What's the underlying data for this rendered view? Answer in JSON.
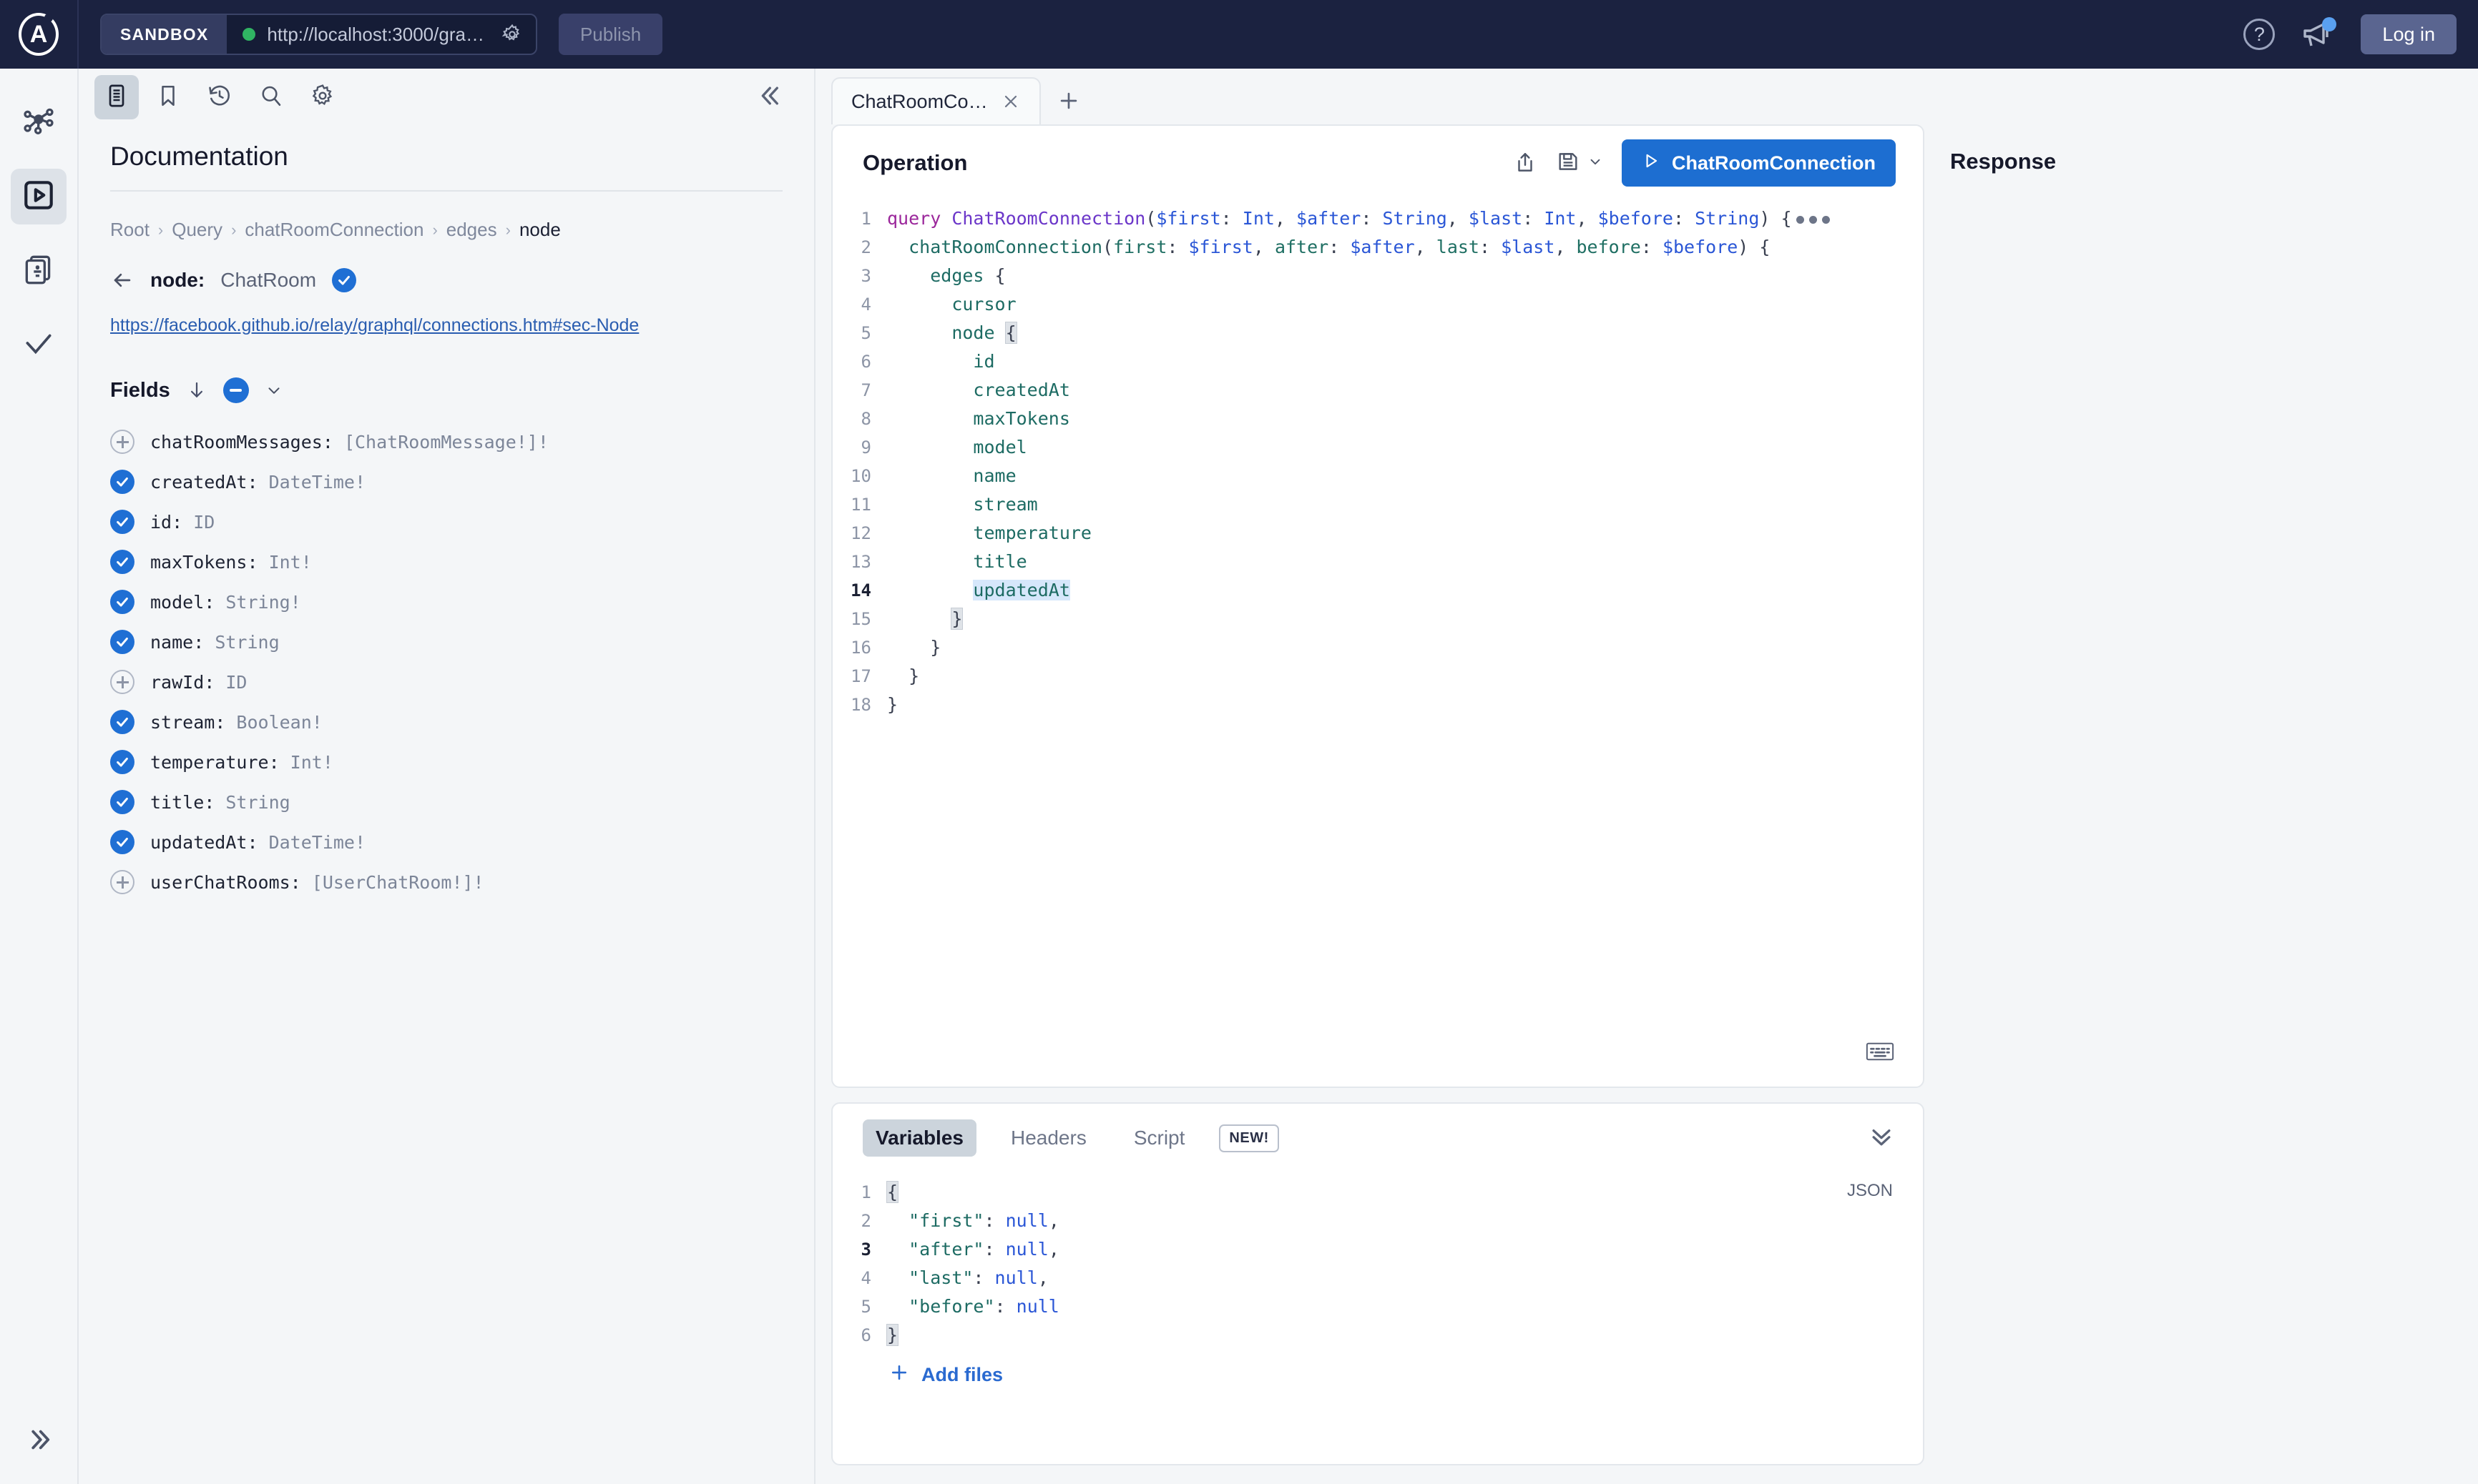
{
  "topbar": {
    "sandbox_label": "SANDBOX",
    "endpoint_url": "http://localhost:3000/gra…",
    "publish_label": "Publish",
    "login_label": "Log in",
    "status_color": "#30b463",
    "accent_color": "#1d6ed1"
  },
  "rail": {
    "items": [
      {
        "name": "graph-icon",
        "title": "Graph"
      },
      {
        "name": "explorer-icon",
        "title": "Explorer"
      },
      {
        "name": "checks-icon",
        "title": "Checks"
      },
      {
        "name": "check-icon",
        "title": "Verify"
      }
    ],
    "expand_label": "»"
  },
  "docs": {
    "tools": [
      "documentation-icon",
      "bookmark-icon",
      "history-icon",
      "search-icon",
      "settings-icon"
    ],
    "title": "Documentation",
    "breadcrumb": [
      "Root",
      "Query",
      "chatRoomConnection",
      "edges",
      "node"
    ],
    "node_name": "node:",
    "node_type": "ChatRoom",
    "doc_link": "https://facebook.github.io/relay/graphql/connections.htm#sec-Node",
    "fields_label": "Fields",
    "fields": [
      {
        "state": "plus",
        "name": "chatRoomMessages:",
        "type": "[ChatRoomMessage!]!"
      },
      {
        "state": "checked",
        "name": "createdAt:",
        "type": "DateTime!"
      },
      {
        "state": "checked",
        "name": "id:",
        "type": "ID"
      },
      {
        "state": "checked",
        "name": "maxTokens:",
        "type": "Int!"
      },
      {
        "state": "checked",
        "name": "model:",
        "type": "String!"
      },
      {
        "state": "checked",
        "name": "name:",
        "type": "String"
      },
      {
        "state": "plus",
        "name": "rawId:",
        "type": "ID"
      },
      {
        "state": "checked",
        "name": "stream:",
        "type": "Boolean!"
      },
      {
        "state": "checked",
        "name": "temperature:",
        "type": "Int!"
      },
      {
        "state": "checked",
        "name": "title:",
        "type": "String"
      },
      {
        "state": "checked",
        "name": "updatedAt:",
        "type": "DateTime!"
      },
      {
        "state": "plus",
        "name": "userChatRooms:",
        "type": "[UserChatRoom!]!"
      }
    ]
  },
  "tabs": {
    "items": [
      {
        "label": "ChatRoomCo…"
      }
    ],
    "add_label": "+"
  },
  "operation": {
    "title": "Operation",
    "run_label": "ChatRoomConnection",
    "current_line": 14,
    "code_lines": [
      {
        "n": 1,
        "raw": "query ChatRoomConnection($first: Int, $after: String, $last: Int, $before: String) {"
      },
      {
        "n": 2,
        "raw": "  chatRoomConnection(first: $first, after: $after, last: $last, before: $before) {"
      },
      {
        "n": 3,
        "raw": "    edges {"
      },
      {
        "n": 4,
        "raw": "      cursor"
      },
      {
        "n": 5,
        "raw": "      node {"
      },
      {
        "n": 6,
        "raw": "        id"
      },
      {
        "n": 7,
        "raw": "        createdAt"
      },
      {
        "n": 8,
        "raw": "        maxTokens"
      },
      {
        "n": 9,
        "raw": "        model"
      },
      {
        "n": 10,
        "raw": "        name"
      },
      {
        "n": 11,
        "raw": "        stream"
      },
      {
        "n": 12,
        "raw": "        temperature"
      },
      {
        "n": 13,
        "raw": "        title"
      },
      {
        "n": 14,
        "raw": "        updatedAt"
      },
      {
        "n": 15,
        "raw": "      }"
      },
      {
        "n": 16,
        "raw": "    }"
      },
      {
        "n": 17,
        "raw": "  }"
      },
      {
        "n": 18,
        "raw": "}"
      }
    ]
  },
  "variables": {
    "tabs": [
      {
        "label": "Variables",
        "active": true
      },
      {
        "label": "Headers",
        "active": false
      },
      {
        "label": "Script",
        "active": false
      }
    ],
    "new_badge": "NEW!",
    "format_label": "JSON",
    "current_line": 3,
    "json_lines": [
      {
        "n": 1,
        "raw": "{"
      },
      {
        "n": 2,
        "raw": "  \"first\": null,"
      },
      {
        "n": 3,
        "raw": "  \"after\": null,"
      },
      {
        "n": 4,
        "raw": "  \"last\": null,"
      },
      {
        "n": 5,
        "raw": "  \"before\": null"
      },
      {
        "n": 6,
        "raw": "}"
      }
    ],
    "add_files_label": "Add files"
  },
  "response": {
    "title": "Response"
  }
}
